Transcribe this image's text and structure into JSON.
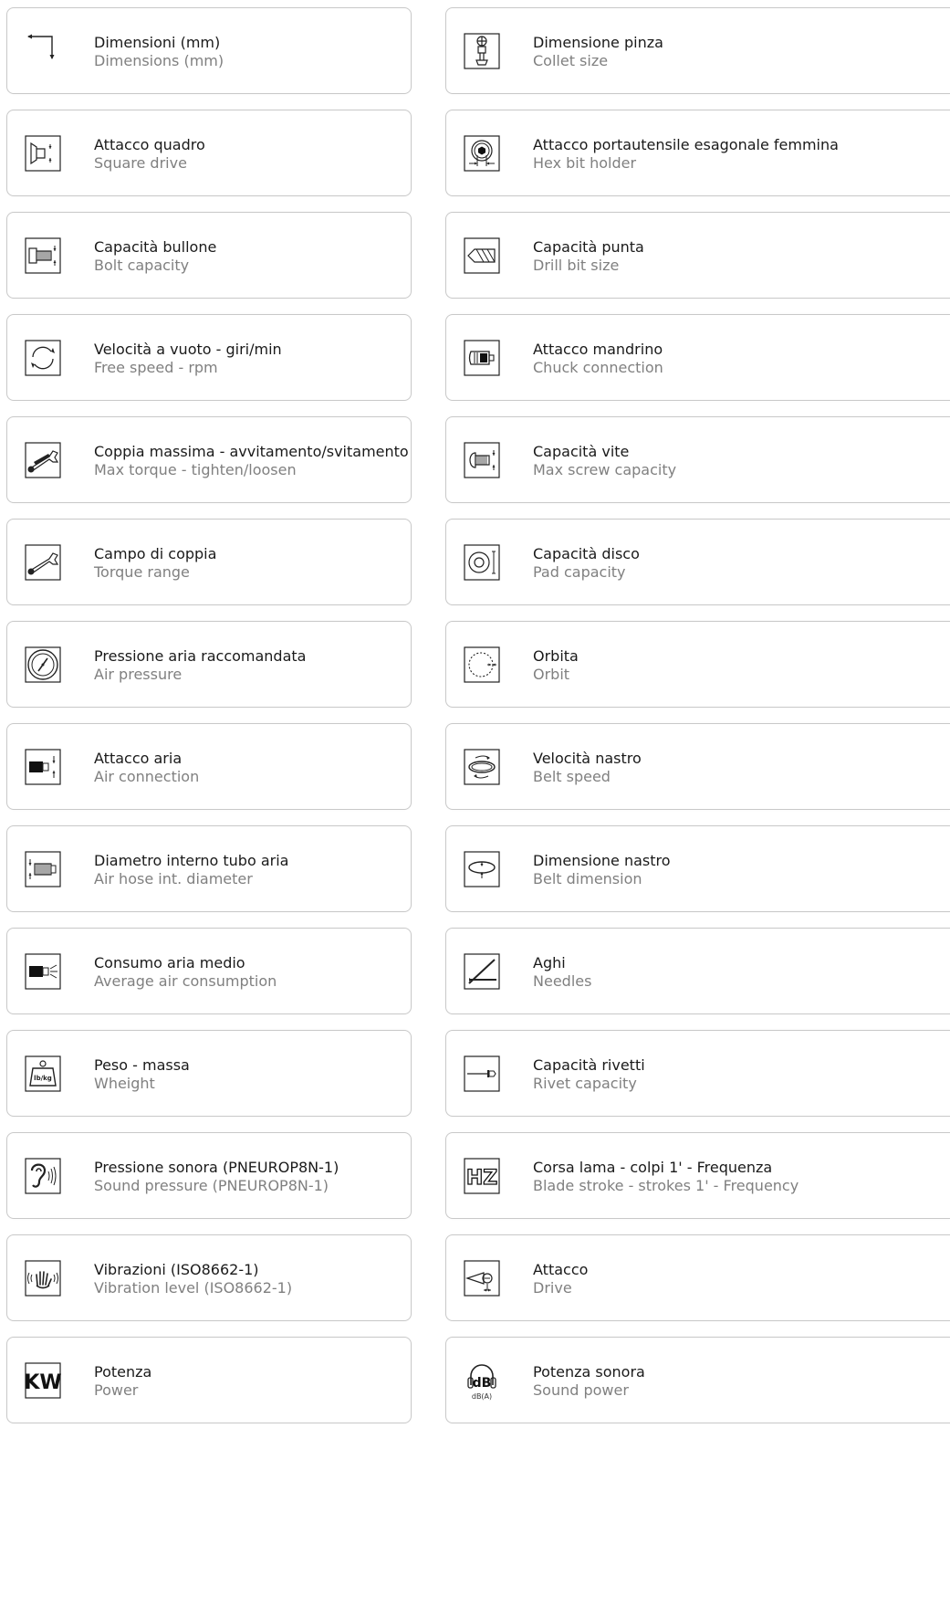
{
  "left": [
    {
      "it": "Dimensioni (mm)",
      "en": "Dimensions (mm)",
      "icon": "dimensions-icon"
    },
    {
      "it": "Attacco quadro",
      "en": "Square drive",
      "icon": "square-drive-icon"
    },
    {
      "it": "Capacità bullone",
      "en": "Bolt capacity",
      "icon": "bolt-capacity-icon"
    },
    {
      "it": "Velocità a vuoto - giri/min",
      "en": "Free speed - rpm",
      "icon": "free-speed-icon"
    },
    {
      "it": "Coppia massima - avvitamento/svitamento",
      "en": "Max torque - tighten/loosen",
      "icon": "max-torque-icon"
    },
    {
      "it": "Campo di coppia",
      "en": "Torque range",
      "icon": "torque-range-icon"
    },
    {
      "it": "Pressione aria raccomandata",
      "en": "Air pressure",
      "icon": "air-pressure-icon"
    },
    {
      "it": "Attacco aria",
      "en": "Air connection",
      "icon": "air-connection-icon"
    },
    {
      "it": "Diametro interno tubo aria",
      "en": "Air hose int. diameter",
      "icon": "air-hose-icon"
    },
    {
      "it": "Consumo aria medio",
      "en": "Average air consumption",
      "icon": "air-consumption-icon"
    },
    {
      "it": "Peso - massa",
      "en": "Wheight",
      "icon": "weight-icon",
      "icon_text": "lb/kg"
    },
    {
      "it": "Pressione sonora (PNEUROP8N-1)",
      "en": "Sound pressure (PNEUROP8N-1)",
      "icon": "ear-icon"
    },
    {
      "it": "Vibrazioni (ISO8662-1)",
      "en": "Vibration level (ISO8662-1)",
      "icon": "vibration-hand-icon"
    },
    {
      "it": "Potenza",
      "en": "Power",
      "icon": "kw-icon",
      "icon_text": "KW"
    }
  ],
  "right": [
    {
      "it": "Dimensione pinza",
      "en": "Collet size",
      "icon": "collet-icon"
    },
    {
      "it": "Attacco portautensile esagonale femmina",
      "en": "Hex bit holder",
      "icon": "hex-bit-holder-icon"
    },
    {
      "it": "Capacità punta",
      "en": "Drill bit size",
      "icon": "drill-bit-icon"
    },
    {
      "it": "Attacco mandrino",
      "en": "Chuck connection",
      "icon": "chuck-icon"
    },
    {
      "it": "Capacità vite",
      "en": "Max screw capacity",
      "icon": "screw-icon"
    },
    {
      "it": "Capacità disco",
      "en": "Pad capacity",
      "icon": "pad-icon"
    },
    {
      "it": "Orbita",
      "en": "Orbit",
      "icon": "orbit-icon"
    },
    {
      "it": "Velocità nastro",
      "en": "Belt speed",
      "icon": "belt-speed-icon"
    },
    {
      "it": "Dimensione nastro",
      "en": "Belt dimension",
      "icon": "belt-dimension-icon"
    },
    {
      "it": "Aghi",
      "en": "Needles",
      "icon": "needles-icon"
    },
    {
      "it": "Capacità rivetti",
      "en": "Rivet capacity",
      "icon": "rivet-icon"
    },
    {
      "it": "Corsa lama - colpi 1' - Frequenza",
      "en": "Blade stroke - strokes 1' - Frequency",
      "icon": "hz-icon",
      "icon_text": "HZ"
    },
    {
      "it": "Attacco",
      "en": "Drive",
      "icon": "drive-icon"
    },
    {
      "it": "Potenza sonora",
      "en": "Sound power",
      "icon": "sound-power-icon",
      "icon_text": "dB",
      "icon_subtext": "dB(A)"
    }
  ]
}
